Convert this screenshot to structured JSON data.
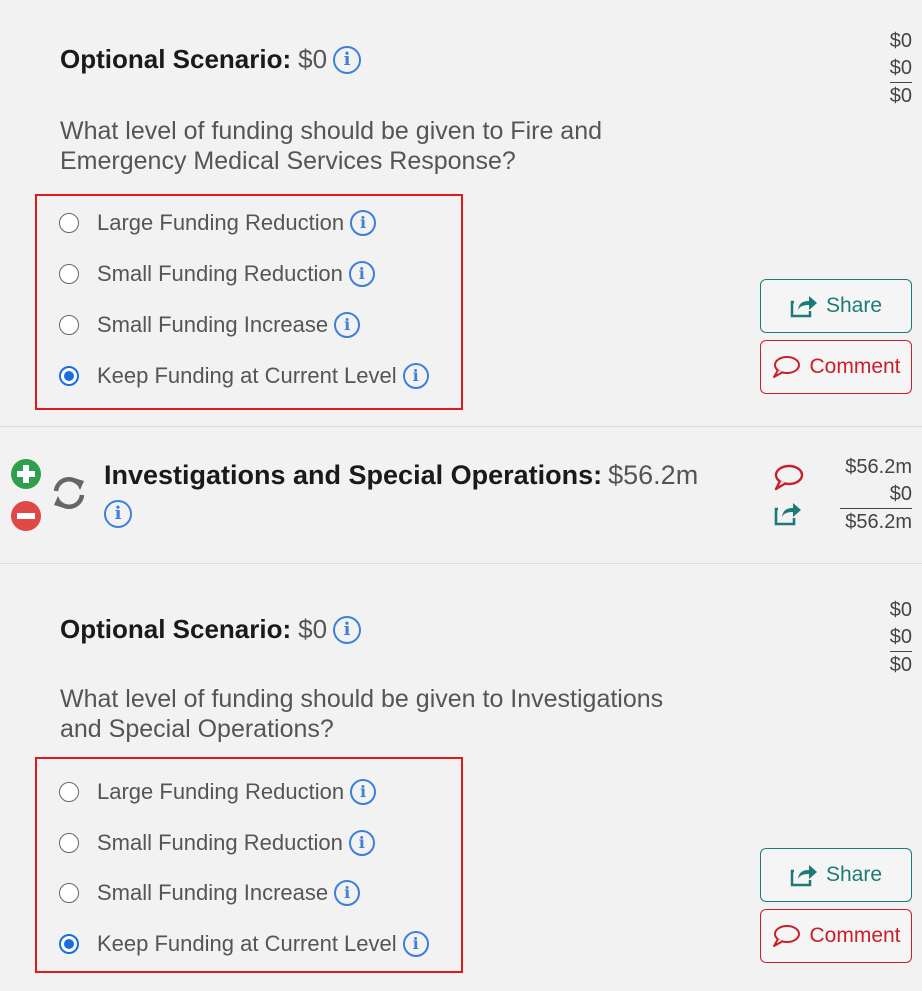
{
  "scenarios": [
    {
      "title_label": "Optional Scenario:",
      "amount": "$0",
      "question": "What level of funding should be given to Fire and Emergency Medical Services Response?",
      "summary": [
        "$0",
        "$0",
        "$0"
      ],
      "options": [
        {
          "label": "Large Funding Reduction",
          "selected": false
        },
        {
          "label": "Small Funding Reduction",
          "selected": false
        },
        {
          "label": "Small Funding Increase",
          "selected": false
        },
        {
          "label": "Keep Funding at Current Level",
          "selected": true
        }
      ],
      "share_label": "Share",
      "comment_label": "Comment"
    },
    {
      "title_label": "Optional Scenario:",
      "amount": "$0",
      "question": "What level of funding should be given to Investigations and Special Operations?",
      "summary": [
        "$0",
        "$0",
        "$0"
      ],
      "options": [
        {
          "label": "Large Funding Reduction",
          "selected": false
        },
        {
          "label": "Small Funding Reduction",
          "selected": false
        },
        {
          "label": "Small Funding Increase",
          "selected": false
        },
        {
          "label": "Keep Funding at Current Level",
          "selected": true
        }
      ],
      "share_label": "Share",
      "comment_label": "Comment"
    }
  ],
  "budget_item": {
    "title_label": "Investigations and Special Operations:",
    "amount": "$56.2m",
    "summary": [
      "$56.2m",
      "$0",
      "$56.2m"
    ]
  },
  "colors": {
    "info_blue": "#3d7fd9",
    "share_teal": "#1e7a78",
    "comment_red": "#c8202a",
    "highlight_red": "#e0191b",
    "add_green": "#2e9e4f",
    "remove_red": "#e04848"
  }
}
